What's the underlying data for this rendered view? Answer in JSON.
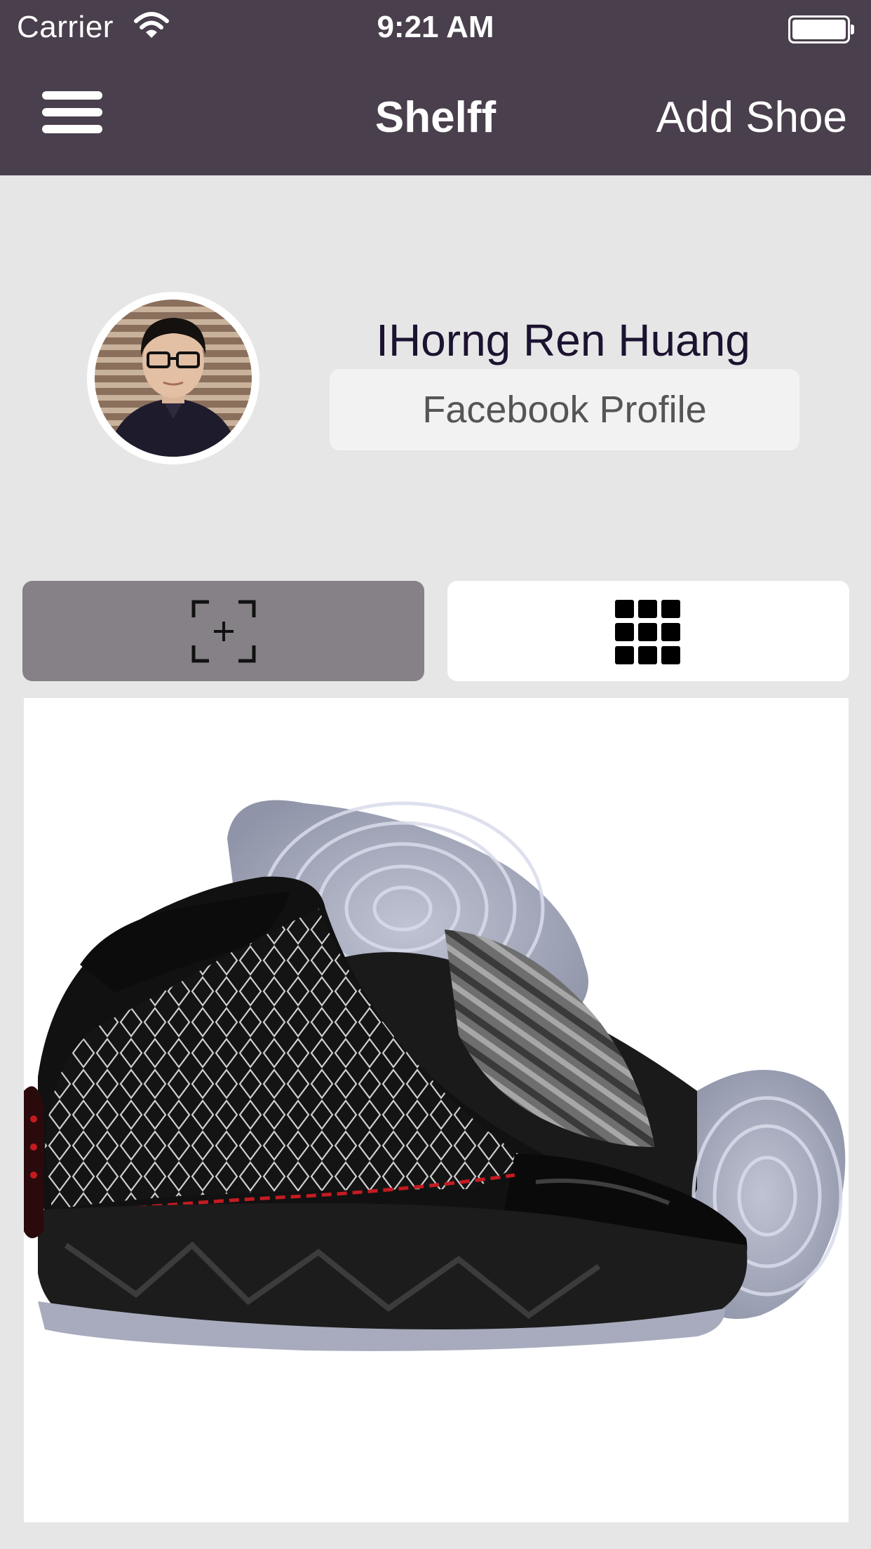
{
  "status_bar": {
    "carrier": "Carrier",
    "time": "9:21 AM"
  },
  "nav": {
    "title": "Shelff",
    "add_shoe_label": "Add Shoe",
    "menu_icon": "hamburger-menu-icon"
  },
  "profile": {
    "name": "IHorng Ren Huang",
    "facebook_button_label": "Facebook Profile"
  },
  "segments": [
    {
      "icon": "scan-add-icon",
      "selected": true
    },
    {
      "icon": "grid-icon",
      "selected": false
    }
  ],
  "colors": {
    "nav_background": "#4a3f4c",
    "page_background": "#e6e6e6",
    "selected_segment": "#858187"
  }
}
